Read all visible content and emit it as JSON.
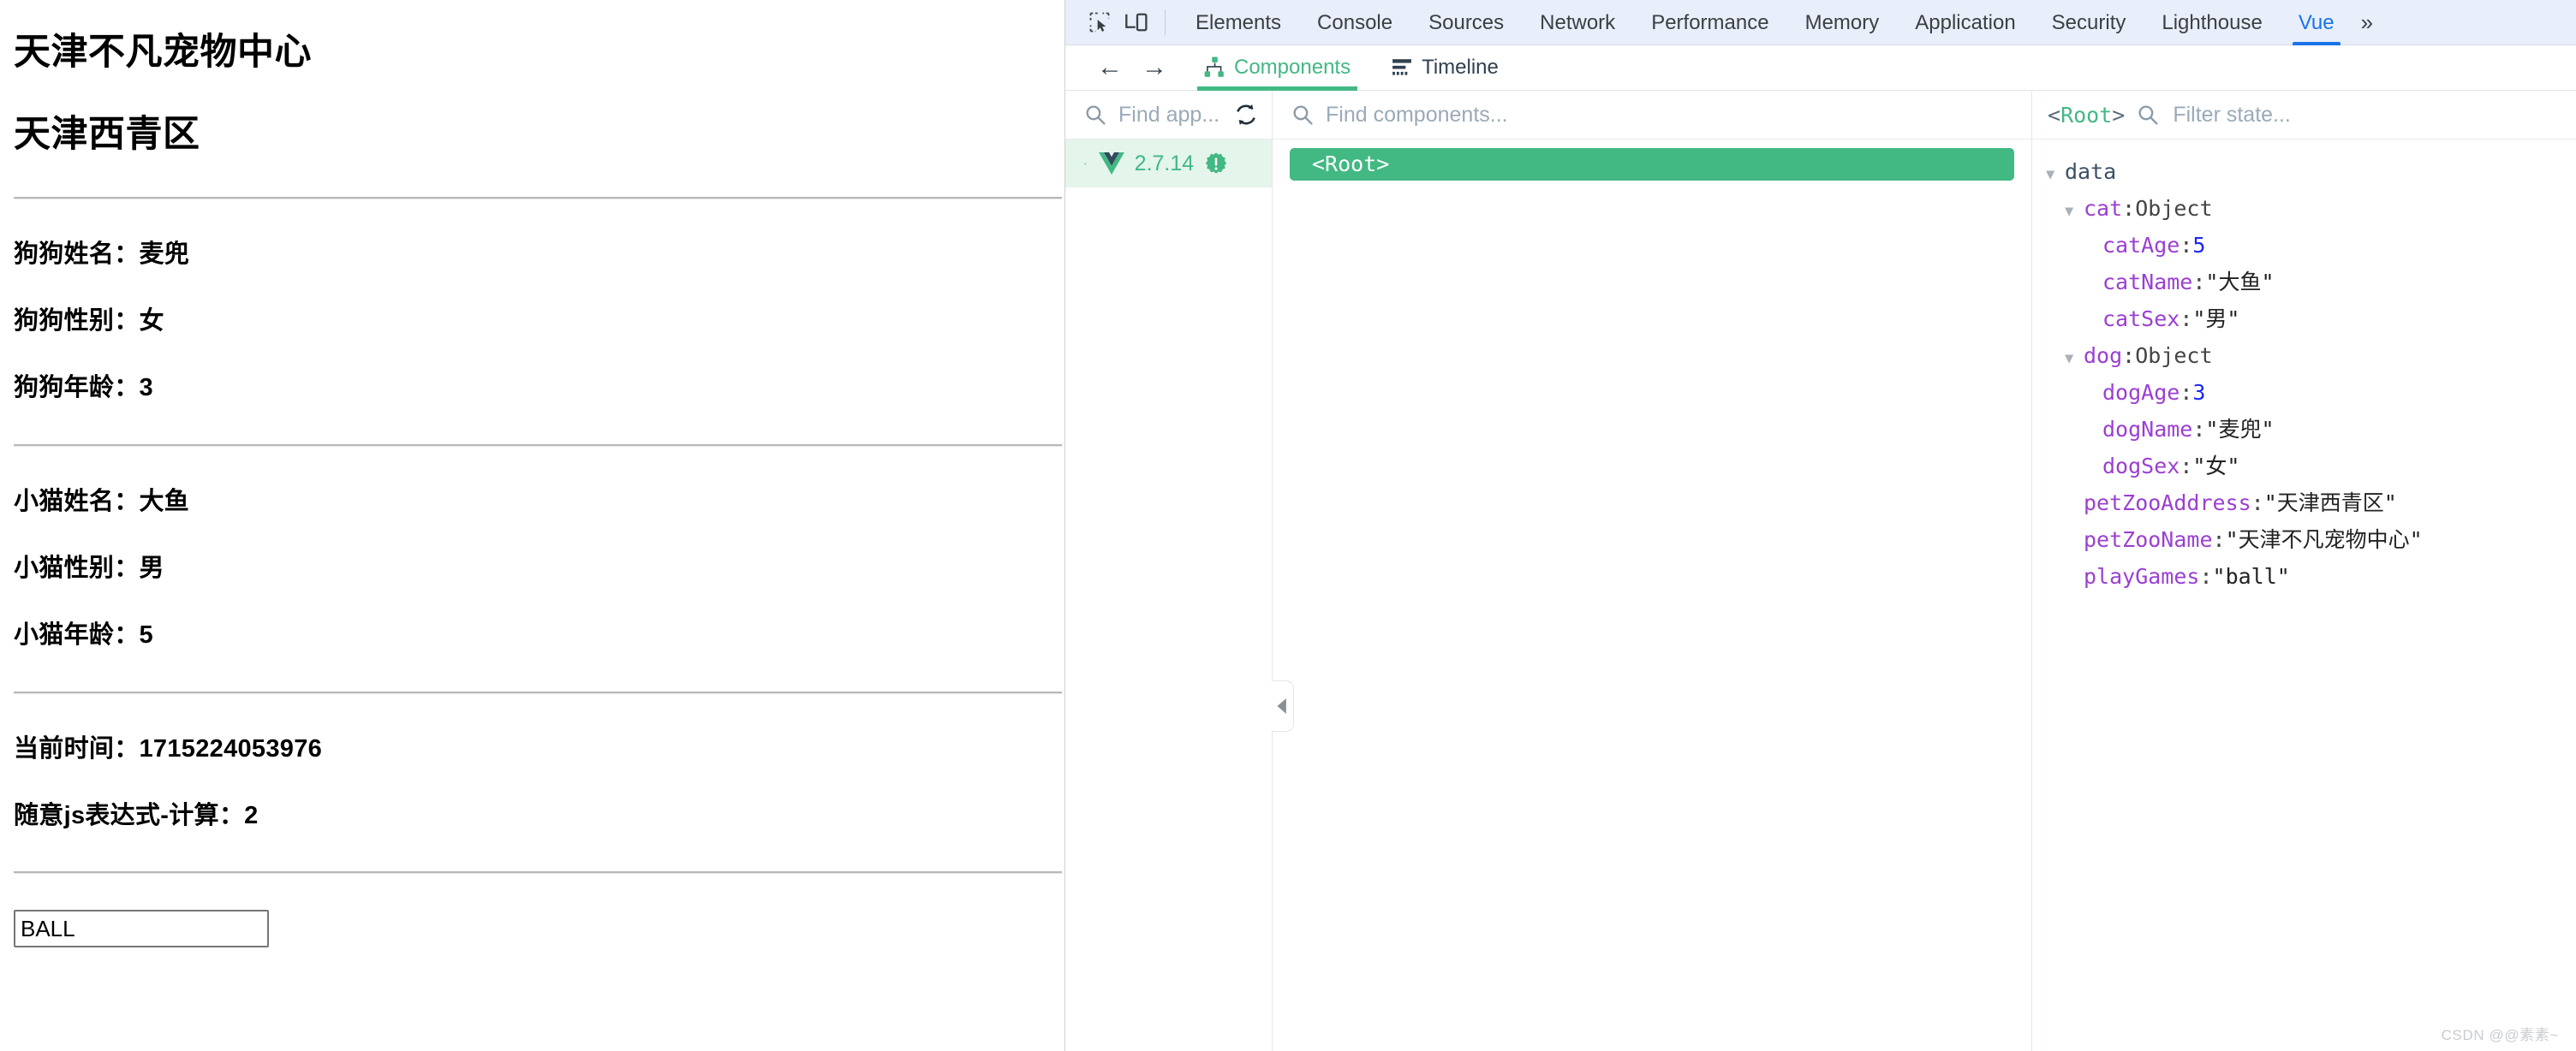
{
  "page": {
    "zoo_name": "天津不凡宠物中心",
    "zoo_address": "天津西青区",
    "rows": [
      {
        "label": "狗狗姓名：麦兜"
      },
      {
        "label": "狗狗性别：女"
      },
      {
        "label": "狗狗年龄：3"
      },
      {
        "label": "小猫姓名：大鱼"
      },
      {
        "label": "小猫性别：男"
      },
      {
        "label": "小猫年龄：5"
      },
      {
        "label": "当前时间：1715224053976"
      },
      {
        "label": "随意js表达式-计算：2"
      }
    ],
    "input_value": "BALL"
  },
  "devtools": {
    "tabs": [
      {
        "label": "Elements",
        "active": false
      },
      {
        "label": "Console",
        "active": false
      },
      {
        "label": "Sources",
        "active": false
      },
      {
        "label": "Network",
        "active": false
      },
      {
        "label": "Performance",
        "active": false
      },
      {
        "label": "Memory",
        "active": false
      },
      {
        "label": "Application",
        "active": false
      },
      {
        "label": "Security",
        "active": false
      },
      {
        "label": "Lighthouse",
        "active": false
      },
      {
        "label": "Vue",
        "active": true
      }
    ],
    "more_label": "»",
    "accent_blue": "#1a73e8",
    "tabbar_bg": "#e8eefa"
  },
  "vue": {
    "accent_green": "#42b883",
    "subtabs": [
      {
        "label": "Components",
        "icon": "components-icon",
        "active": true
      },
      {
        "label": "Timeline",
        "icon": "timeline-icon",
        "active": false
      }
    ],
    "apps": {
      "search_placeholder": "Find app...",
      "search_value": "",
      "refresh_icon": "refresh-icon",
      "item": {
        "version": "2.7.14",
        "logo_icon": "vue-logo-icon",
        "badge_icon": "warning-badge-icon"
      }
    },
    "tree": {
      "search_placeholder": "Find components...",
      "search_value": "",
      "root_node": "<Root>"
    },
    "state": {
      "component_name": "<Root>",
      "filter_placeholder": "Filter state...",
      "filter_value": "",
      "group": "data",
      "entries": [
        {
          "indent": 0,
          "caret": true,
          "key": "cat",
          "sep": ": ",
          "value": "Object",
          "vtype": "type"
        },
        {
          "indent": 1,
          "caret": false,
          "key": "catAge",
          "sep": ": ",
          "value": "5",
          "vtype": "num"
        },
        {
          "indent": 1,
          "caret": false,
          "key": "catName",
          "sep": ": ",
          "value": "\"大鱼\"",
          "vtype": "str"
        },
        {
          "indent": 1,
          "caret": false,
          "key": "catSex",
          "sep": ": ",
          "value": "\"男\"",
          "vtype": "str"
        },
        {
          "indent": 0,
          "caret": true,
          "key": "dog",
          "sep": ": ",
          "value": "Object",
          "vtype": "type"
        },
        {
          "indent": 1,
          "caret": false,
          "key": "dogAge",
          "sep": ": ",
          "value": "3",
          "vtype": "num"
        },
        {
          "indent": 1,
          "caret": false,
          "key": "dogName",
          "sep": ": ",
          "value": "\"麦兜\"",
          "vtype": "str"
        },
        {
          "indent": 1,
          "caret": false,
          "key": "dogSex",
          "sep": ": ",
          "value": "\"女\"",
          "vtype": "str"
        },
        {
          "indent": 0,
          "caret": false,
          "key": "petZooAddress",
          "sep": ": ",
          "value": "\"天津西青区\"",
          "vtype": "str"
        },
        {
          "indent": 0,
          "caret": false,
          "key": "petZooName",
          "sep": ": ",
          "value": "\"天津不凡宠物中心\"",
          "vtype": "str"
        },
        {
          "indent": 0,
          "caret": false,
          "key": "playGames",
          "sep": ": ",
          "value": "\"ball\"",
          "vtype": "str"
        }
      ]
    }
  },
  "watermark": "CSDN @@素素~"
}
